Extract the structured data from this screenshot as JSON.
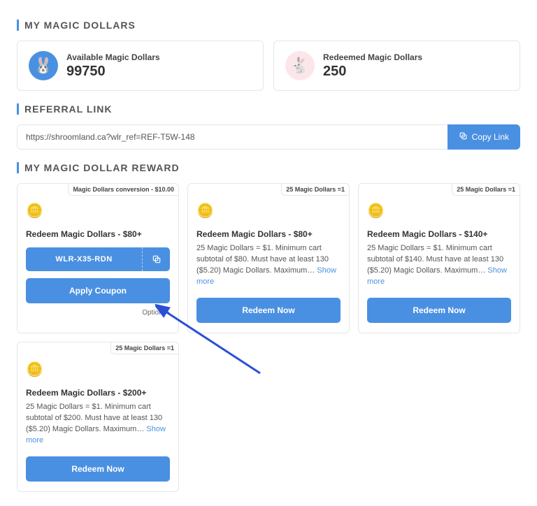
{
  "sections": {
    "magic_dollars_title": "MY MAGIC DOLLARS",
    "referral_title": "REFERRAL LINK",
    "reward_title": "MY MAGIC DOLLAR REWARD"
  },
  "summary": {
    "available_label": "Available Magic Dollars",
    "available_value": "99750",
    "redeemed_label": "Redeemed Magic Dollars",
    "redeemed_value": "250"
  },
  "referral": {
    "url": "https://shroomland.ca?wlr_ref=REF-T5W-148",
    "copy_label": "Copy Link"
  },
  "rewards": {
    "card0": {
      "tag": "Magic Dollars conversion - $10.00",
      "title": "Redeem Magic Dollars - $80+",
      "coupon": "WLR-X35-RDN",
      "apply_label": "Apply Coupon",
      "options_label": "Options"
    },
    "card1": {
      "tag": "25 Magic Dollars =1",
      "title": "Redeem Magic Dollars - $80+",
      "desc": "25 Magic Dollars = $1. Minimum cart subtotal of $80. Must have at least 130 ($5.20) Magic Dollars. Maximum…",
      "show_more": "Show more",
      "redeem_label": "Redeem Now"
    },
    "card2": {
      "tag": "25 Magic Dollars =1",
      "title": "Redeem Magic Dollars - $140+",
      "desc": "25 Magic Dollars = $1. Minimum cart subtotal of $140. Must have at least 130 ($5.20) Magic Dollars. Maximum…",
      "show_more": "Show more",
      "redeem_label": "Redeem Now"
    },
    "card3": {
      "tag": "25 Magic Dollars =1",
      "title": "Redeem Magic Dollars - $200+",
      "desc": "25 Magic Dollars = $1. Minimum cart subtotal of $200. Must have at least 130 ($5.20) Magic Dollars. Maximum…",
      "show_more": "Show more",
      "redeem_label": "Redeem Now"
    }
  }
}
